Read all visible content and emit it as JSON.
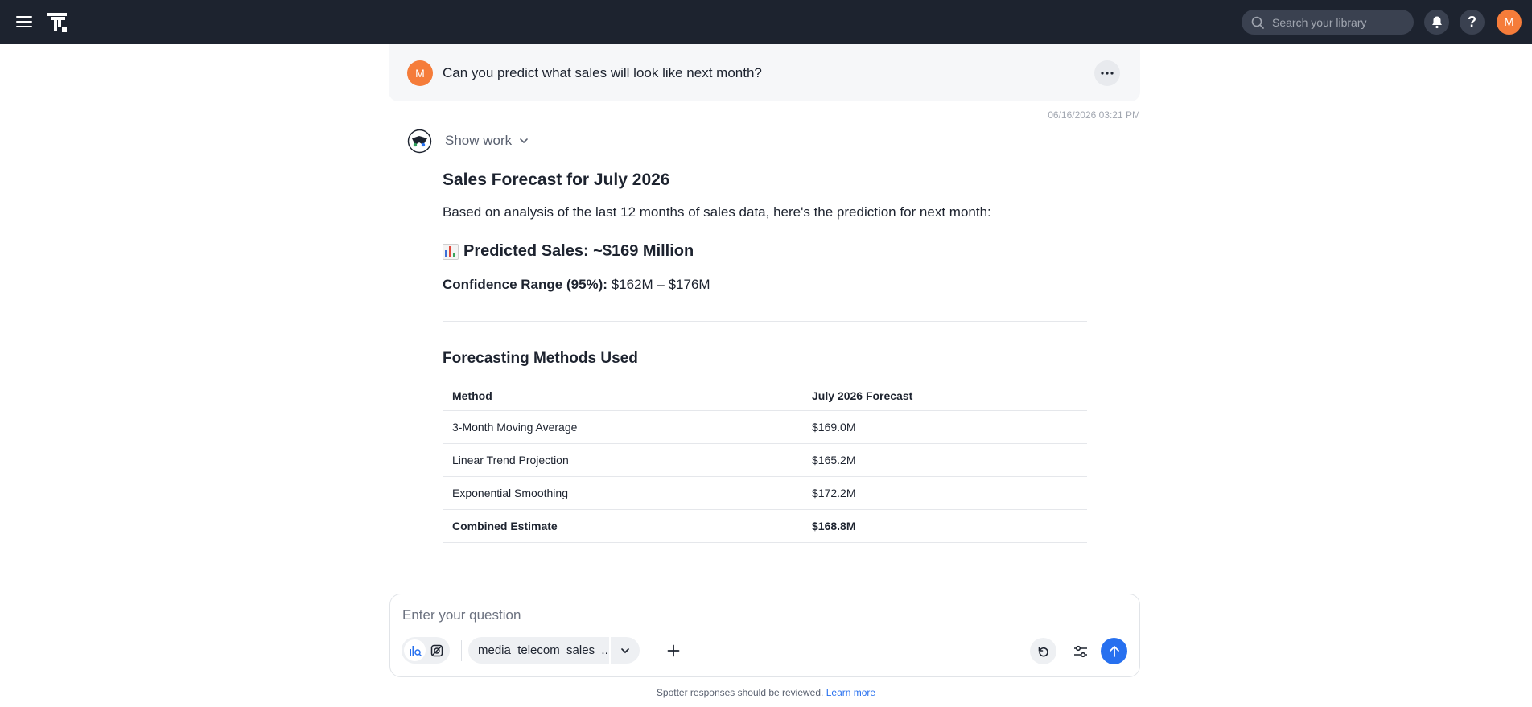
{
  "header": {
    "search_placeholder": "Search your library",
    "help_label": "?",
    "user_initial": "M"
  },
  "question": {
    "user_initial": "M",
    "text": "Can you predict what sales will look like next month?",
    "timestamp": "06/16/2026 03:21 PM"
  },
  "answer": {
    "show_work_label": "Show work",
    "title": "Sales Forecast for July 2026",
    "intro": "Based on analysis of the last 12 months of sales data, here's the prediction for next month:",
    "predicted_label": "Predicted Sales: ~$169 Million",
    "confidence_label": "Confidence Range (95%):",
    "confidence_value": "$162M – $176M",
    "methods_heading": "Forecasting Methods Used",
    "table": {
      "headers": [
        "Method",
        "July 2026 Forecast"
      ],
      "rows": [
        [
          "3-Month Moving Average",
          "$169.0M"
        ],
        [
          "Linear Trend Projection",
          "$165.2M"
        ],
        [
          "Exponential Smoothing",
          "$172.2M"
        ],
        [
          "Combined Estimate",
          "$168.8M"
        ]
      ]
    }
  },
  "composer": {
    "placeholder": "Enter your question",
    "data_source": "media_telecom_sales_..."
  },
  "footer": {
    "notice": "Spotter responses should be reviewed.",
    "link": "Learn more"
  },
  "colors": {
    "topbar": "#1d232f",
    "avatar": "#f57c3a",
    "accent": "#2770ef"
  }
}
